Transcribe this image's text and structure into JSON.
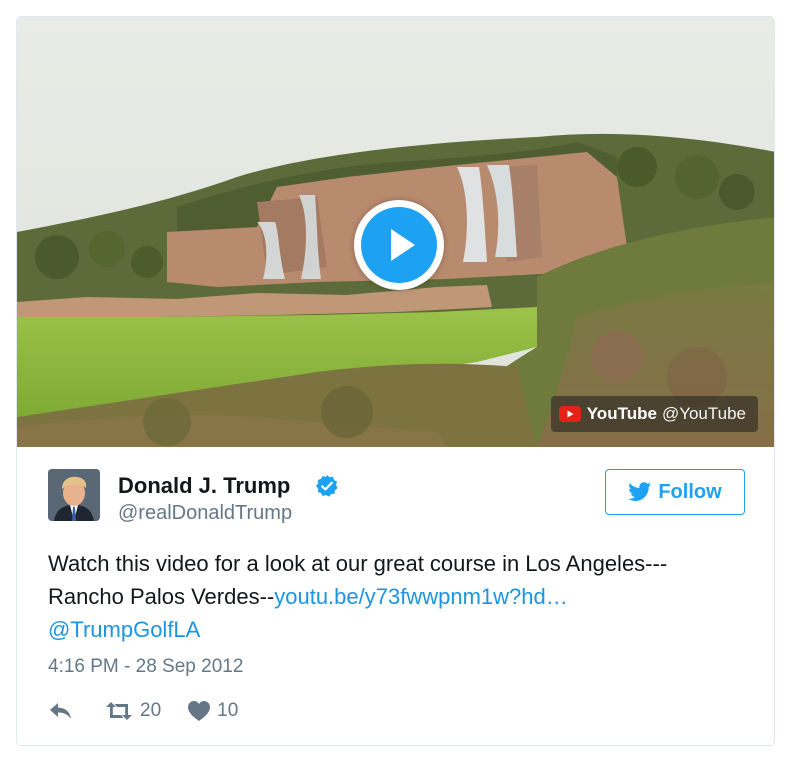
{
  "media": {
    "provider_label": "YouTube",
    "provider_handle": "@YouTube",
    "play_icon": "play-icon"
  },
  "author": {
    "display_name": "Donald J. Trump",
    "handle": "@realDonaldTrump",
    "verified_icon": "verified-badge-icon"
  },
  "follow": {
    "label": "Follow",
    "icon": "twitter-bird-icon"
  },
  "tweet": {
    "text_line1": "Watch this video for a look at our great course in Los Angeles---",
    "text_line2_prefix": "Rancho Palos Verdes--",
    "link_text": "youtu.be/y73fwwpnm1w?hd…",
    "mention": "@TrumpGolfLA",
    "timestamp": "4:16 PM - 28 Sep 2012"
  },
  "actions": {
    "retweet_count": "20",
    "like_count": "10"
  },
  "colors": {
    "accent": "#1da1f2",
    "link": "#1b95e0",
    "text": "#14171a",
    "muted": "#657786",
    "youtube_red": "#e62117"
  }
}
